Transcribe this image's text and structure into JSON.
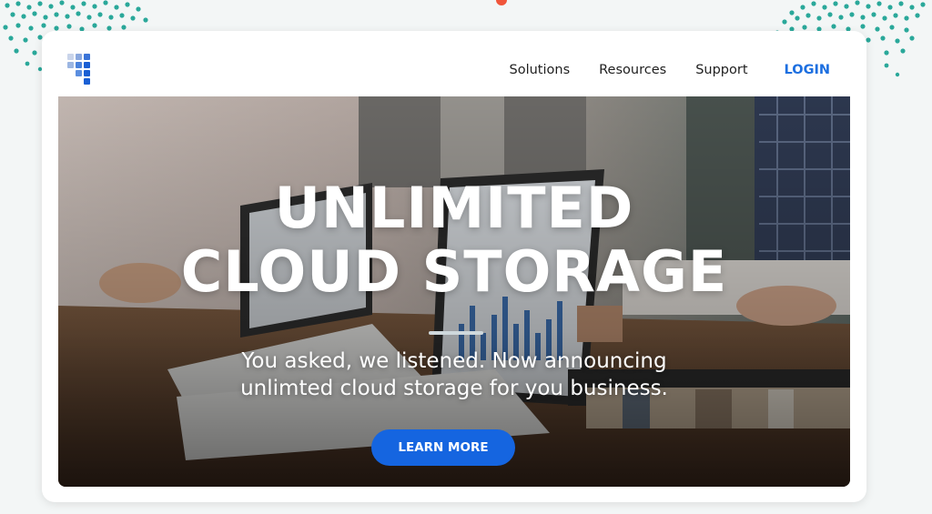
{
  "nav": {
    "logo_icon": "grid-logo-icon",
    "links": [
      {
        "label": "Solutions"
      },
      {
        "label": "Resources"
      },
      {
        "label": "Support"
      }
    ],
    "login_label": "LOGIN"
  },
  "hero": {
    "headline_line1": "UNLIMITED",
    "headline_line2": "CLOUD STORAGE",
    "subtitle_line1": "You asked, we listened. Now announcing",
    "subtitle_line2": "unlimted cloud storage for you business.",
    "cta_label": "LEARN MORE",
    "background_image": "office-team-laptops-photo"
  },
  "colors": {
    "accent": "#1565e0",
    "login": "#1d6fe0",
    "dots": "#2aa89a",
    "marker": "#f0553a"
  }
}
